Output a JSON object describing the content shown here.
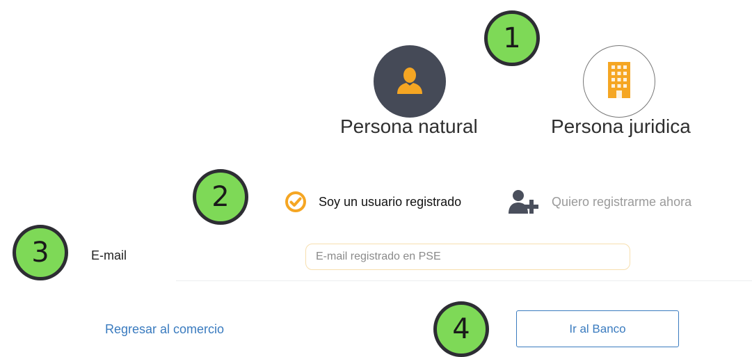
{
  "steps": [
    "1",
    "2",
    "3",
    "4"
  ],
  "person_type": {
    "options": [
      {
        "label": "Persona natural",
        "icon": "person-icon",
        "selected": true
      },
      {
        "label": "Persona juridica",
        "icon": "building-icon",
        "selected": false
      }
    ]
  },
  "user_mode": {
    "options": [
      {
        "label": "Soy un usuario registrado",
        "icon": "check-circle-icon",
        "selected": true
      },
      {
        "label": "Quiero registrarme ahora",
        "icon": "add-user-icon",
        "selected": false
      }
    ]
  },
  "email": {
    "label": "E-mail",
    "value": "",
    "placeholder": "E-mail registrado en PSE"
  },
  "actions": {
    "back_label": "Regresar al comercio",
    "bank_label": "Ir al Banco"
  },
  "colors": {
    "badge": "#7ed957",
    "accent_orange": "#f5a623",
    "link_blue": "#3a7bbf",
    "selected_circle": "#454a57"
  }
}
